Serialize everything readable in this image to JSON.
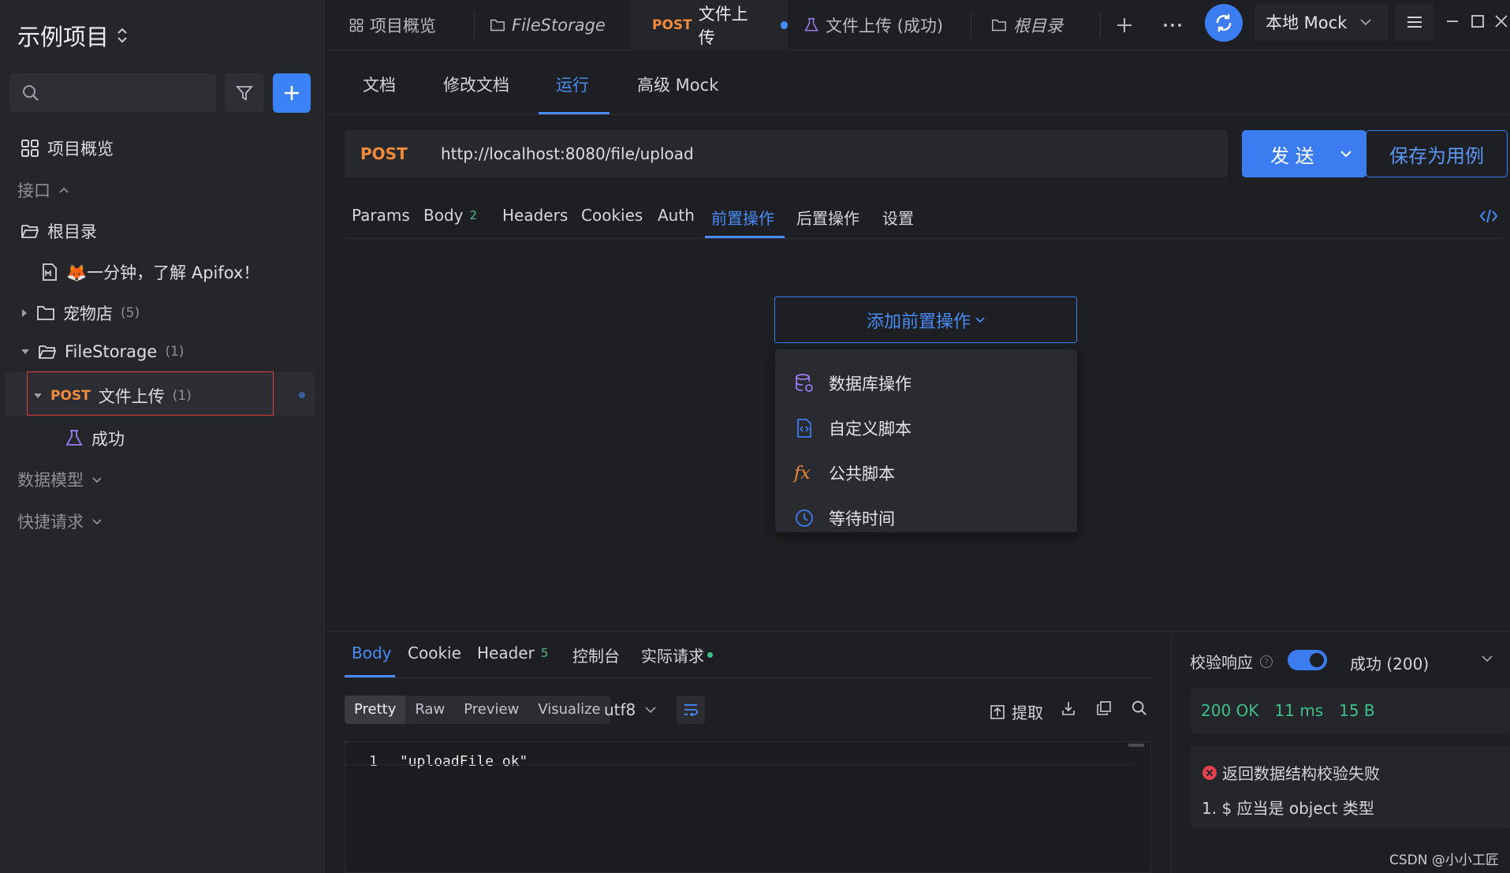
{
  "sidebar": {
    "project_title": "示例项目",
    "search_placeholder": "",
    "overview_label": "项目概览",
    "api_section": "接口",
    "root_folder": "根目录",
    "doc_item": "🦊一分钟，了解 Apifox！",
    "folders": [
      {
        "name": "宠物店",
        "count": "(5)"
      },
      {
        "name": "FileStorage",
        "count": "(1)"
      }
    ],
    "selected_api": {
      "method": "POST",
      "name": "文件上传",
      "count": "(1)"
    },
    "case_item": "成功",
    "data_model": "数据模型",
    "quick_request": "快捷请求"
  },
  "top_tabs": [
    {
      "label": "项目概览"
    },
    {
      "label": "FileStorage"
    },
    {
      "method": "POST",
      "label": "文件上传"
    },
    {
      "label": "文件上传 (成功)"
    },
    {
      "label": "根目录"
    }
  ],
  "env": {
    "label": "本地 Mock"
  },
  "sub_tabs": [
    "文档",
    "修改文档",
    "运行",
    "高级 Mock"
  ],
  "request": {
    "method": "POST",
    "url": "http://localhost:8080/file/upload",
    "send_label": "发 送",
    "save_label": "保存为用例"
  },
  "req_tabs": [
    {
      "label": "Params"
    },
    {
      "label": "Body",
      "badge": "2"
    },
    {
      "label": "Headers"
    },
    {
      "label": "Cookies"
    },
    {
      "label": "Auth"
    },
    {
      "label": "前置操作"
    },
    {
      "label": "后置操作"
    },
    {
      "label": "设置"
    }
  ],
  "pre_ops": {
    "button_label": "添加前置操作",
    "menu": [
      "数据库操作",
      "自定义脚本",
      "公共脚本",
      "等待时间"
    ]
  },
  "response": {
    "tabs": [
      {
        "label": "Body"
      },
      {
        "label": "Cookie"
      },
      {
        "label": "Header",
        "badge": "5"
      },
      {
        "label": "控制台"
      },
      {
        "label": "实际请求"
      }
    ],
    "view_modes": [
      "Pretty",
      "Raw",
      "Preview",
      "Visualize"
    ],
    "encoding": "utf8",
    "extract_label": "提取",
    "code_line_no": "1",
    "code_text": "\"uploadFile ok\""
  },
  "verify": {
    "label": "校验响应",
    "result_select": "成功 (200)",
    "status": "200 OK",
    "time": "11 ms",
    "size": "15 B",
    "error_title": "返回数据结构校验失败",
    "error_detail": "1. $ 应当是 object 类型"
  },
  "watermark": "CSDN @小小工匠",
  "colors": {
    "accent": "#3b7cf0",
    "post": "#f08c3b",
    "success": "#3fbf8a",
    "error": "#e0434f"
  }
}
